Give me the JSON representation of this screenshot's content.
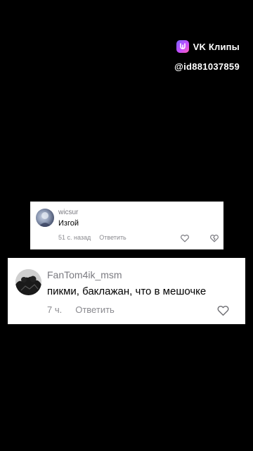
{
  "watermark": {
    "brand": "VK Клипы",
    "handle": "@id881037859"
  },
  "comments": [
    {
      "username": "wicsur",
      "text": "Изгой",
      "time": "51 с. назад",
      "reply": "Ответить",
      "avatar_icon": "user-avatar",
      "like_icon": "heart-icon",
      "dislike_icon": "heart-broken-icon"
    },
    {
      "username": "FanTom4ik_msm",
      "text": "пикми, баклажан, что в мешочке",
      "time": "7 ч.",
      "reply": "Ответить",
      "avatar_icon": "user-avatar",
      "like_icon": "heart-icon"
    }
  ],
  "colors": {
    "background": "#000000",
    "card": "#ffffff",
    "muted_text": "#8a8a8f",
    "vk_gradient_start": "#7b61ff",
    "vk_gradient_end": "#ff5fb4"
  }
}
